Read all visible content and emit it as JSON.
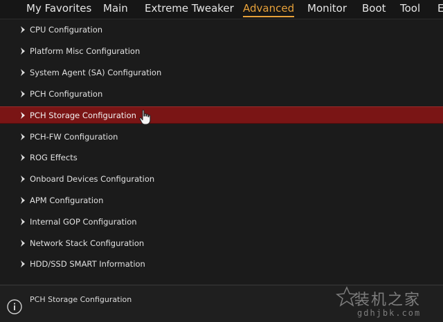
{
  "nav": {
    "tabs": [
      {
        "label": "My Favorites",
        "active": false
      },
      {
        "label": "Main",
        "active": false
      },
      {
        "label": "Extreme Tweaker",
        "active": false
      },
      {
        "label": "Advanced",
        "active": true
      },
      {
        "label": "Monitor",
        "active": false
      },
      {
        "label": "Boot",
        "active": false
      },
      {
        "label": "Tool",
        "active": false
      },
      {
        "label": "E",
        "active": false
      }
    ]
  },
  "menu": {
    "items": [
      {
        "label": "CPU Configuration",
        "selected": false
      },
      {
        "label": "Platform Misc Configuration",
        "selected": false
      },
      {
        "label": "System Agent (SA) Configuration",
        "selected": false
      },
      {
        "label": "PCH Configuration",
        "selected": false
      },
      {
        "label": "PCH Storage Configuration",
        "selected": true
      },
      {
        "label": "PCH-FW Configuration",
        "selected": false
      },
      {
        "label": "ROG Effects",
        "selected": false
      },
      {
        "label": "Onboard Devices Configuration",
        "selected": false
      },
      {
        "label": "APM Configuration",
        "selected": false
      },
      {
        "label": "Internal GOP Configuration",
        "selected": false
      },
      {
        "label": "Network Stack Configuration",
        "selected": false
      },
      {
        "label": "HDD/SSD SMART Information",
        "selected": false
      }
    ],
    "arrow_icon": "chevron-right-icon"
  },
  "help": {
    "icon": "info-icon",
    "text": "PCH Storage Configuration"
  },
  "watermark": {
    "main": "装机之家",
    "sub": "gdhjbk.com"
  },
  "colors": {
    "accent": "#e8a23a",
    "selected_row": "#7a1515",
    "background": "#1b1b1b",
    "text": "#e0e0e0"
  }
}
